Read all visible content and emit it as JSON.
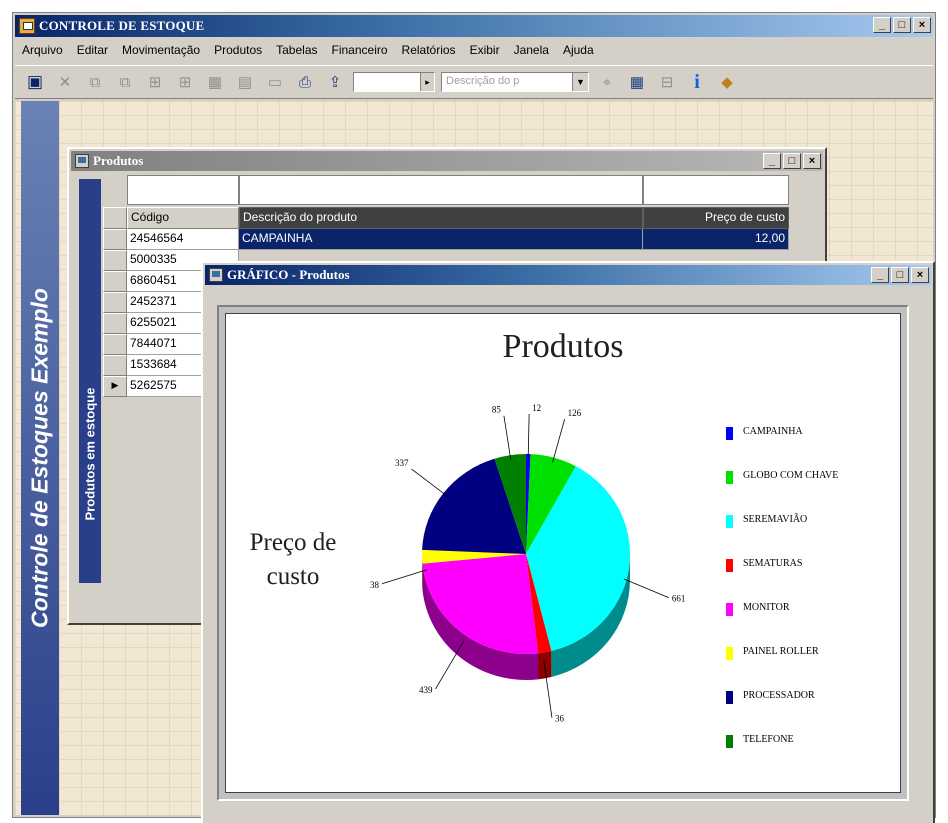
{
  "app": {
    "title": "CONTROLE DE ESTOQUE",
    "window_buttons": [
      "_",
      "□",
      "×"
    ]
  },
  "menu": [
    "Arquivo",
    "Editar",
    "Movimentação",
    "Produtos",
    "Tabelas",
    "Financeiro",
    "Relatórios",
    "Exibir",
    "Janela",
    "Ajuda"
  ],
  "toolbar": {
    "search_placeholder": "Descrição do p"
  },
  "side_banner": "Controle de Estoques Exemplo",
  "produtos_window": {
    "title": "Produtos",
    "vertical_label": "Produtos em estoque",
    "columns": [
      "Código",
      "Descrição do produto",
      "Preço de custo"
    ],
    "rows": [
      {
        "codigo": "24546564",
        "descricao": "CAMPAINHA",
        "preco": "12,00",
        "selected": true
      },
      {
        "codigo": "5000335",
        "descricao": "",
        "preco": ""
      },
      {
        "codigo": "6860451",
        "descricao": "",
        "preco": ""
      },
      {
        "codigo": "2452371",
        "descricao": "",
        "preco": ""
      },
      {
        "codigo": "6255021",
        "descricao": "",
        "preco": ""
      },
      {
        "codigo": "7844071",
        "descricao": "",
        "preco": ""
      },
      {
        "codigo": "1533684",
        "descricao": "",
        "preco": ""
      },
      {
        "codigo": "5262575",
        "descricao": "",
        "preco": "",
        "current": true
      }
    ]
  },
  "chart_window": {
    "title": "GRÁFICO - Produtos"
  },
  "chart_data": {
    "type": "pie",
    "title": "Produtos",
    "ylabel": "Preço de custo",
    "categories": [
      "CAMPAINHA",
      "GLOBO COM CHAVE",
      "SEREMAVIÃO",
      "SEMATURAS",
      "MONITOR",
      "PAINEL ROLLER",
      "PROCESSADOR",
      "TELEFONE"
    ],
    "values": [
      12,
      126,
      661,
      36,
      439,
      38,
      337,
      85
    ],
    "value_labels": [
      "12",
      "126",
      "661",
      "36",
      "439",
      "38",
      "337",
      "85"
    ],
    "colors": [
      "#0000ff",
      "#00e000",
      "#00ffff",
      "#ff0000",
      "#ff00ff",
      "#ffff00",
      "#000080",
      "#008000"
    ],
    "legend": "right"
  }
}
